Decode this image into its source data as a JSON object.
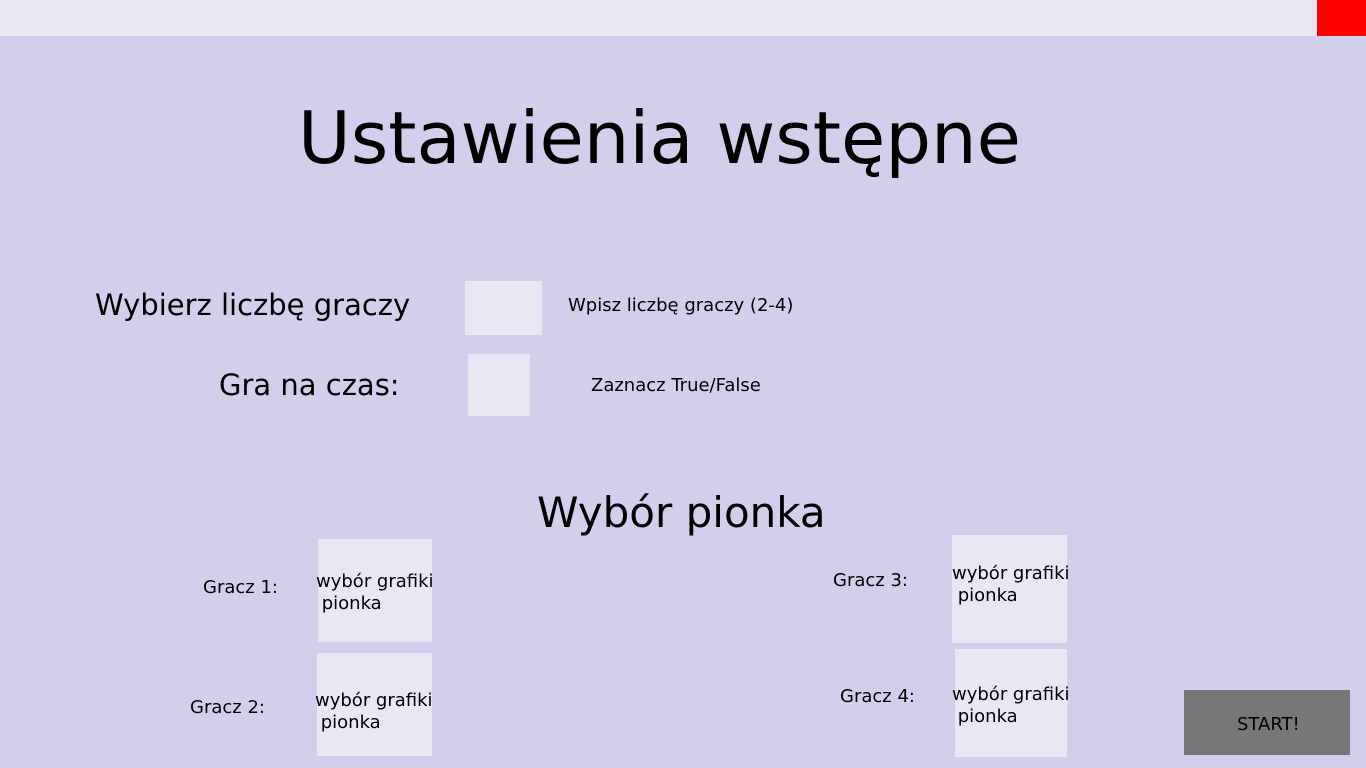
{
  "window": {
    "close_color": "#ff0000"
  },
  "title": "Ustawienia wstępne",
  "players_count": {
    "label": "Wybierz liczbę graczy",
    "value": "",
    "hint": "Wpisz liczbę graczy (2-4)"
  },
  "timed_game": {
    "label": "Gra na czas:",
    "value": "",
    "hint": "Zaznacz True/False"
  },
  "pawn_section": {
    "title": "Wybór pionka",
    "players": [
      {
        "label": "Gracz 1:",
        "line1": "wybór grafiki",
        "line2": " pionka"
      },
      {
        "label": "Gracz 2:",
        "line1": "wybór grafiki",
        "line2": " pionka"
      },
      {
        "label": "Gracz 3:",
        "line1": "wybór grafiki",
        "line2": " pionka"
      },
      {
        "label": "Gracz 4:",
        "line1": "wybór grafiki",
        "line2": " pionka"
      }
    ]
  },
  "start_button": {
    "label": "START!"
  }
}
